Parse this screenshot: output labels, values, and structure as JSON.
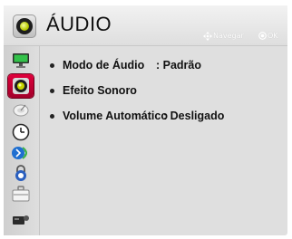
{
  "header": {
    "title": "ÁUDIO",
    "icon": "speaker-icon",
    "hint_navigate": "Navegar",
    "hint_ok": "OK"
  },
  "sidebar": {
    "items": [
      {
        "name": "picture",
        "icon": "monitor-icon",
        "selected": false
      },
      {
        "name": "audio",
        "icon": "speaker-icon",
        "selected": true
      },
      {
        "name": "channels",
        "icon": "satellite-dish-icon",
        "selected": false
      },
      {
        "name": "time",
        "icon": "clock-icon",
        "selected": false
      },
      {
        "name": "network",
        "icon": "network-icon",
        "selected": false
      },
      {
        "name": "lock",
        "icon": "lock-icon",
        "selected": false
      },
      {
        "name": "options",
        "icon": "briefcase-icon",
        "selected": false
      },
      {
        "name": "input",
        "icon": "device-icon",
        "selected": false
      }
    ]
  },
  "settings": [
    {
      "label": "Modo de Áudio",
      "value": ": Padrão"
    },
    {
      "label": "Efeito Sonoro",
      "value": ""
    },
    {
      "label": "Volume Automático",
      "value": ": Desligado"
    }
  ],
  "colors": {
    "selection_accent": "#c4003a",
    "speaker_cone": "#c7d600",
    "background": "#dfdfdf"
  }
}
